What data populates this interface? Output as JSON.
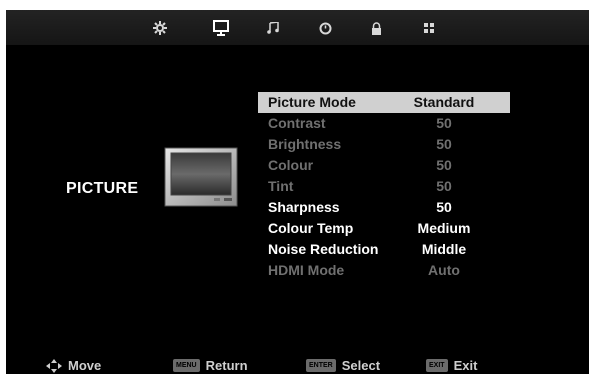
{
  "top_icons": [
    {
      "name": "settings-icon",
      "glyph": "⚙"
    },
    {
      "name": "picture-icon",
      "glyph": "🖳"
    },
    {
      "name": "sound-icon",
      "glyph": "♫"
    },
    {
      "name": "time-icon",
      "glyph": "⊙"
    },
    {
      "name": "lock-icon",
      "glyph": "🔒"
    },
    {
      "name": "grid-icon",
      "glyph": "▦"
    }
  ],
  "section": {
    "title": "PICTURE"
  },
  "menu": [
    {
      "label": "Picture Mode",
      "value": "Standard",
      "state": "selected"
    },
    {
      "label": "Contrast",
      "value": "50",
      "state": "disabled"
    },
    {
      "label": "Brightness",
      "value": "50",
      "state": "disabled"
    },
    {
      "label": "Colour",
      "value": "50",
      "state": "disabled"
    },
    {
      "label": "Tint",
      "value": "50",
      "state": "disabled"
    },
    {
      "label": "Sharpness",
      "value": "50",
      "state": "enabled"
    },
    {
      "label": "Colour Temp",
      "value": "Medium",
      "state": "enabled"
    },
    {
      "label": "Noise Reduction",
      "value": "Middle",
      "state": "enabled"
    },
    {
      "label": "HDMI Mode",
      "value": "Auto",
      "state": "disabled"
    }
  ],
  "hints": {
    "move": {
      "label": "Move"
    },
    "return": {
      "key": "MENU",
      "label": "Return"
    },
    "select": {
      "key": "ENTER",
      "label": "Select"
    },
    "exit": {
      "key": "EXIT",
      "label": "Exit"
    }
  }
}
